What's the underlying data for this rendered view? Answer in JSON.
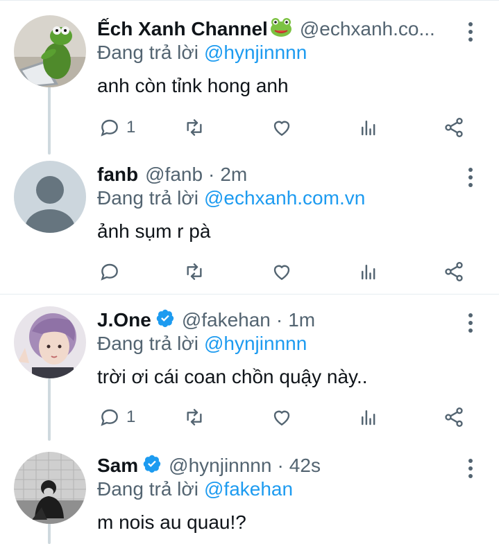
{
  "tweets": [
    {
      "name": "Ếch Xanh Channel",
      "handle": "@echxanh.co...",
      "time": "",
      "verified": false,
      "name_emoji": "frog-face",
      "replying_prefix": "Đang trả lời",
      "replying_to": "@hynjinnnn",
      "text": "anh còn tỉnk hong anh",
      "reply_count": "1",
      "avatar": "kermit-frog-laptop"
    },
    {
      "name": "fanb",
      "handle": "@fanb",
      "time": "2m",
      "verified": false,
      "replying_prefix": "Đang trả lời",
      "replying_to": "@echxanh.com.vn",
      "text": "ảnh sụm r pà",
      "reply_count": "",
      "avatar": "default-profile"
    },
    {
      "name": "J.One",
      "handle": "@fakehan",
      "time": "1m",
      "verified": true,
      "replying_prefix": "Đang trả lời",
      "replying_to": "@hynjinnnn",
      "text": "trời ơi cái coan chồn quậy này..",
      "reply_count": "1",
      "avatar": "purple-hair-person"
    },
    {
      "name": "Sam",
      "handle": "@hynjinnnn",
      "time": "42s",
      "verified": true,
      "replying_prefix": "Đang trả lời",
      "replying_to": "@fakehan",
      "text": "m nois au quau!?",
      "reply_count": "",
      "avatar": "person-crouching-bw"
    }
  ],
  "separator": "·",
  "icons": {
    "reply": "reply-icon",
    "retweet": "retweet-icon",
    "like": "heart-icon",
    "analytics": "analytics-icon",
    "share": "share-icon",
    "more": "more-vertical-icon",
    "verified": "verified-badge-icon"
  },
  "colors": {
    "link": "#1d9bf0",
    "secondary_text": "#536471",
    "primary_text": "#0f1419",
    "thread_line": "#cfd9de",
    "divider": "#e6ecf0"
  }
}
